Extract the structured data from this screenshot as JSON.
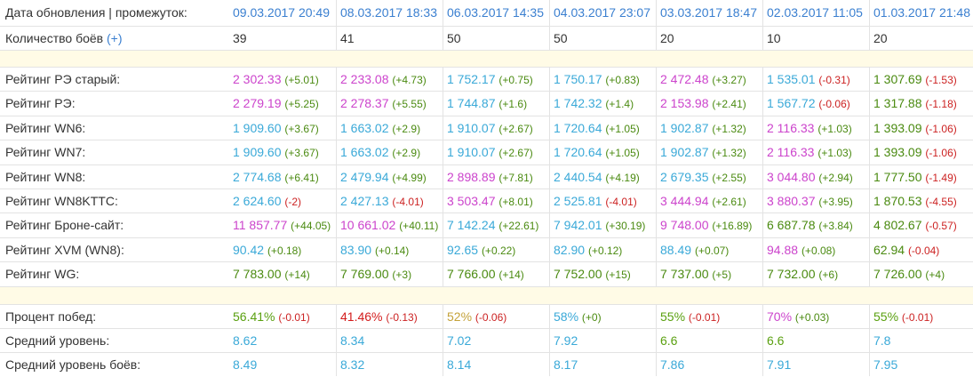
{
  "colors": {
    "pink": "#cc44cc",
    "blue": "#3aa9d8",
    "green": "#4a8a10",
    "olive": "#5aa010",
    "yellow": "#c4a23a",
    "red": "#cc2222",
    "darkred": "#d31c1c",
    "date": "#3a7fd0"
  },
  "header": {
    "label": "Дата обновления | промежуток:",
    "dates": [
      "09.03.2017 20:49",
      "08.03.2017 18:33",
      "06.03.2017 14:35",
      "04.03.2017 23:07",
      "03.03.2017 18:47",
      "02.03.2017 11:05",
      "01.03.2017 21:48"
    ]
  },
  "battles": {
    "label": "Количество боёв",
    "link": "(+)",
    "values": [
      "39",
      "41",
      "50",
      "50",
      "20",
      "10",
      "20"
    ]
  },
  "ratings": [
    {
      "label": "Рейтинг РЭ старый:",
      "cells": [
        {
          "v": "2 302.33",
          "d": "(+5.01)",
          "c": "pink",
          "dc": "green"
        },
        {
          "v": "2 233.08",
          "d": "(+4.73)",
          "c": "pink",
          "dc": "green"
        },
        {
          "v": "1 752.17",
          "d": "(+0.75)",
          "c": "blue",
          "dc": "green"
        },
        {
          "v": "1 750.17",
          "d": "(+0.83)",
          "c": "blue",
          "dc": "green"
        },
        {
          "v": "2 472.48",
          "d": "(+3.27)",
          "c": "pink",
          "dc": "green"
        },
        {
          "v": "1 535.01",
          "d": "(-0.31)",
          "c": "blue",
          "dc": "red"
        },
        {
          "v": "1 307.69",
          "d": "(-1.53)",
          "c": "green",
          "dc": "red"
        }
      ]
    },
    {
      "label": "Рейтинг РЭ:",
      "cells": [
        {
          "v": "2 279.19",
          "d": "(+5.25)",
          "c": "pink",
          "dc": "green"
        },
        {
          "v": "2 278.37",
          "d": "(+5.55)",
          "c": "pink",
          "dc": "green"
        },
        {
          "v": "1 744.87",
          "d": "(+1.6)",
          "c": "blue",
          "dc": "green"
        },
        {
          "v": "1 742.32",
          "d": "(+1.4)",
          "c": "blue",
          "dc": "green"
        },
        {
          "v": "2 153.98",
          "d": "(+2.41)",
          "c": "pink",
          "dc": "green"
        },
        {
          "v": "1 567.72",
          "d": "(-0.06)",
          "c": "blue",
          "dc": "red"
        },
        {
          "v": "1 317.88",
          "d": "(-1.18)",
          "c": "green",
          "dc": "red"
        }
      ]
    },
    {
      "label": "Рейтинг WN6:",
      "cells": [
        {
          "v": "1 909.60",
          "d": "(+3.67)",
          "c": "blue",
          "dc": "green"
        },
        {
          "v": "1 663.02",
          "d": "(+2.9)",
          "c": "blue",
          "dc": "green"
        },
        {
          "v": "1 910.07",
          "d": "(+2.67)",
          "c": "blue",
          "dc": "green"
        },
        {
          "v": "1 720.64",
          "d": "(+1.05)",
          "c": "blue",
          "dc": "green"
        },
        {
          "v": "1 902.87",
          "d": "(+1.32)",
          "c": "blue",
          "dc": "green"
        },
        {
          "v": "2 116.33",
          "d": "(+1.03)",
          "c": "pink",
          "dc": "green"
        },
        {
          "v": "1 393.09",
          "d": "(-1.06)",
          "c": "green",
          "dc": "red"
        }
      ]
    },
    {
      "label": "Рейтинг WN7:",
      "cells": [
        {
          "v": "1 909.60",
          "d": "(+3.67)",
          "c": "blue",
          "dc": "green"
        },
        {
          "v": "1 663.02",
          "d": "(+2.9)",
          "c": "blue",
          "dc": "green"
        },
        {
          "v": "1 910.07",
          "d": "(+2.67)",
          "c": "blue",
          "dc": "green"
        },
        {
          "v": "1 720.64",
          "d": "(+1.05)",
          "c": "blue",
          "dc": "green"
        },
        {
          "v": "1 902.87",
          "d": "(+1.32)",
          "c": "blue",
          "dc": "green"
        },
        {
          "v": "2 116.33",
          "d": "(+1.03)",
          "c": "pink",
          "dc": "green"
        },
        {
          "v": "1 393.09",
          "d": "(-1.06)",
          "c": "green",
          "dc": "red"
        }
      ]
    },
    {
      "label": "Рейтинг WN8:",
      "cells": [
        {
          "v": "2 774.68",
          "d": "(+6.41)",
          "c": "blue",
          "dc": "green"
        },
        {
          "v": "2 479.94",
          "d": "(+4.99)",
          "c": "blue",
          "dc": "green"
        },
        {
          "v": "2 898.89",
          "d": "(+7.81)",
          "c": "pink",
          "dc": "green"
        },
        {
          "v": "2 440.54",
          "d": "(+4.19)",
          "c": "blue",
          "dc": "green"
        },
        {
          "v": "2 679.35",
          "d": "(+2.55)",
          "c": "blue",
          "dc": "green"
        },
        {
          "v": "3 044.80",
          "d": "(+2.94)",
          "c": "pink",
          "dc": "green"
        },
        {
          "v": "1 777.50",
          "d": "(-1.49)",
          "c": "green",
          "dc": "red"
        }
      ]
    },
    {
      "label": "Рейтинг WN8KTTC:",
      "cells": [
        {
          "v": "2 624.60",
          "d": "(-2)",
          "c": "blue",
          "dc": "red"
        },
        {
          "v": "2 427.13",
          "d": "(-4.01)",
          "c": "blue",
          "dc": "red"
        },
        {
          "v": "3 503.47",
          "d": "(+8.01)",
          "c": "pink",
          "dc": "green"
        },
        {
          "v": "2 525.81",
          "d": "(-4.01)",
          "c": "blue",
          "dc": "red"
        },
        {
          "v": "3 444.94",
          "d": "(+2.61)",
          "c": "pink",
          "dc": "green"
        },
        {
          "v": "3 880.37",
          "d": "(+3.95)",
          "c": "pink",
          "dc": "green"
        },
        {
          "v": "1 870.53",
          "d": "(-4.55)",
          "c": "green",
          "dc": "red"
        }
      ]
    },
    {
      "label": "Рейтинг Броне-сайт:",
      "cells": [
        {
          "v": "11 857.77",
          "d": "(+44.05)",
          "c": "pink",
          "dc": "green"
        },
        {
          "v": "10 661.02",
          "d": "(+40.11)",
          "c": "pink",
          "dc": "green"
        },
        {
          "v": "7 142.24",
          "d": "(+22.61)",
          "c": "blue",
          "dc": "green"
        },
        {
          "v": "7 942.01",
          "d": "(+30.19)",
          "c": "blue",
          "dc": "green"
        },
        {
          "v": "9 748.00",
          "d": "(+16.89)",
          "c": "pink",
          "dc": "green"
        },
        {
          "v": "6 687.78",
          "d": "(+3.84)",
          "c": "green",
          "dc": "green"
        },
        {
          "v": "4 802.67",
          "d": "(-0.57)",
          "c": "green",
          "dc": "red"
        }
      ]
    },
    {
      "label": "Рейтинг XVM (WN8):",
      "cells": [
        {
          "v": "90.42",
          "d": "(+0.18)",
          "c": "blue",
          "dc": "green"
        },
        {
          "v": "83.90",
          "d": "(+0.14)",
          "c": "blue",
          "dc": "green"
        },
        {
          "v": "92.65",
          "d": "(+0.22)",
          "c": "blue",
          "dc": "green"
        },
        {
          "v": "82.90",
          "d": "(+0.12)",
          "c": "blue",
          "dc": "green"
        },
        {
          "v": "88.49",
          "d": "(+0.07)",
          "c": "blue",
          "dc": "green"
        },
        {
          "v": "94.88",
          "d": "(+0.08)",
          "c": "pink",
          "dc": "green"
        },
        {
          "v": "62.94",
          "d": "(-0.04)",
          "c": "green",
          "dc": "red"
        }
      ]
    },
    {
      "label": "Рейтинг WG:",
      "cells": [
        {
          "v": "7 783.00",
          "d": "(+14)",
          "c": "green",
          "dc": "green"
        },
        {
          "v": "7 769.00",
          "d": "(+3)",
          "c": "green",
          "dc": "green"
        },
        {
          "v": "7 766.00",
          "d": "(+14)",
          "c": "green",
          "dc": "green"
        },
        {
          "v": "7 752.00",
          "d": "(+15)",
          "c": "green",
          "dc": "green"
        },
        {
          "v": "7 737.00",
          "d": "(+5)",
          "c": "green",
          "dc": "green"
        },
        {
          "v": "7 732.00",
          "d": "(+6)",
          "c": "green",
          "dc": "green"
        },
        {
          "v": "7 726.00",
          "d": "(+4)",
          "c": "green",
          "dc": "green"
        }
      ]
    }
  ],
  "stats": [
    {
      "label": "Процент побед:",
      "cells": [
        {
          "v": "56.41%",
          "d": "(-0.01)",
          "c": "olive",
          "dc": "red"
        },
        {
          "v": "41.46%",
          "d": "(-0.13)",
          "c": "darkred",
          "dc": "red"
        },
        {
          "v": "52%",
          "d": "(-0.06)",
          "c": "yellow",
          "dc": "red"
        },
        {
          "v": "58%",
          "d": "(+0)",
          "c": "blue",
          "dc": "green"
        },
        {
          "v": "55%",
          "d": "(-0.01)",
          "c": "olive",
          "dc": "red"
        },
        {
          "v": "70%",
          "d": "(+0.03)",
          "c": "pink",
          "dc": "green"
        },
        {
          "v": "55%",
          "d": "(-0.01)",
          "c": "olive",
          "dc": "red"
        }
      ]
    },
    {
      "label": "Средний уровень:",
      "cells": [
        {
          "v": "8.62",
          "d": "",
          "c": "blue",
          "dc": "green"
        },
        {
          "v": "8.34",
          "d": "",
          "c": "blue",
          "dc": "green"
        },
        {
          "v": "7.02",
          "d": "",
          "c": "blue",
          "dc": "green"
        },
        {
          "v": "7.92",
          "d": "",
          "c": "blue",
          "dc": "green"
        },
        {
          "v": "6.6",
          "d": "",
          "c": "olive",
          "dc": "green"
        },
        {
          "v": "6.6",
          "d": "",
          "c": "olive",
          "dc": "green"
        },
        {
          "v": "7.8",
          "d": "",
          "c": "blue",
          "dc": "green"
        }
      ]
    },
    {
      "label": "Средний уровень боёв:",
      "cells": [
        {
          "v": "8.49",
          "d": "",
          "c": "blue",
          "dc": "green"
        },
        {
          "v": "8.32",
          "d": "",
          "c": "blue",
          "dc": "green"
        },
        {
          "v": "8.14",
          "d": "",
          "c": "blue",
          "dc": "green"
        },
        {
          "v": "8.17",
          "d": "",
          "c": "blue",
          "dc": "green"
        },
        {
          "v": "7.86",
          "d": "",
          "c": "blue",
          "dc": "green"
        },
        {
          "v": "7.91",
          "d": "",
          "c": "blue",
          "dc": "green"
        },
        {
          "v": "7.95",
          "d": "",
          "c": "blue",
          "dc": "green"
        }
      ]
    }
  ]
}
